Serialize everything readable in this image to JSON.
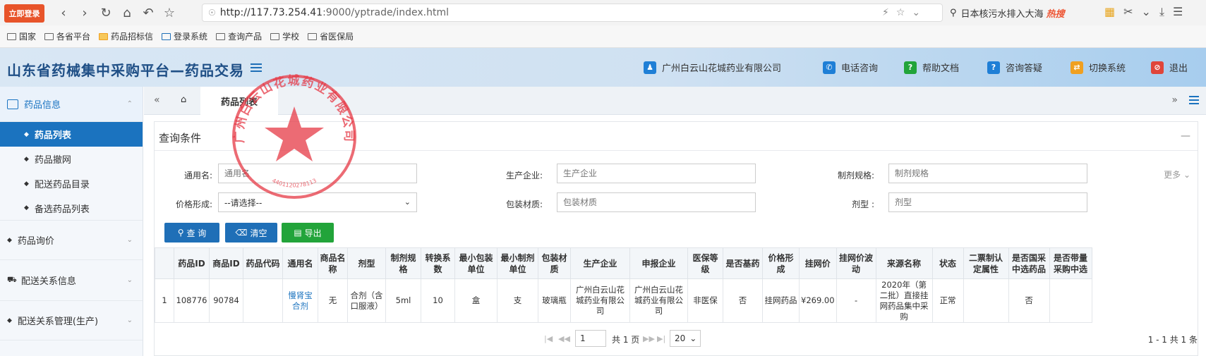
{
  "browser": {
    "login_badge": "立即登录",
    "url_host": "http://117.73.254.41",
    "url_path": ":9000/yptrade/index.html",
    "search_text": "日本核污水排入大海",
    "search_hot": "热搜",
    "bookmarks": [
      "国家",
      "各省平台",
      "药品招标信",
      "登录系统",
      "查询产品",
      "学校",
      "省医保局"
    ]
  },
  "header": {
    "title": "山东省药械集中采购平台—药品交易",
    "company": "广州白云山花城药业有限公司",
    "phone": "电话咨询",
    "help": "帮助文档",
    "faq": "咨询答疑",
    "switch": "切换系统",
    "logout": "退出",
    "colors": {
      "company": "#1f7fd6",
      "phone": "#1f7fd6",
      "help": "#22a43a",
      "faq": "#1f7fd6",
      "switch": "#f0a020",
      "logout": "#e0453a"
    }
  },
  "sidebar": {
    "section_drug": "药品信息",
    "items": [
      "药品列表",
      "药品撤网",
      "配送药品目录",
      "备选药品列表"
    ],
    "section_inquiry": "药品询价",
    "section_delivery": "配送关系信息",
    "section_delivery_mgmt": "配送关系管理(生产)"
  },
  "tabs": {
    "active": "药品列表"
  },
  "query": {
    "title": "查询条件",
    "more": "更多",
    "generic_name_label": "通用名:",
    "generic_name_placeholder": "通用名",
    "manufacturer_label": "生产企业:",
    "manufacturer_placeholder": "生产企业",
    "spec_label": "制剂规格:",
    "spec_placeholder": "制剂规格",
    "price_label": "价格形成:",
    "price_value": "--请选择--",
    "package_label": "包装材质:",
    "package_placeholder": "包装材质",
    "dosage_label": "剂型 :",
    "dosage_placeholder": "剂型",
    "btn_query": "查 询",
    "btn_clear": "清空",
    "btn_export": "导出"
  },
  "table": {
    "headers": [
      "药品ID",
      "商品ID",
      "药品代码",
      "通用名",
      "商品名称",
      "剂型",
      "制剂规格",
      "转换系数",
      "最小包装单位",
      "最小制剂单位",
      "包装材质",
      "生产企业",
      "申报企业",
      "医保等级",
      "是否基药",
      "价格形成",
      "挂网价",
      "挂网价波动",
      "来源名称",
      "状态",
      "二票制认定属性",
      "是否国采中选药品",
      "是否带量采购中选"
    ],
    "rows": [
      [
        "1",
        "108776",
        "90784",
        "",
        "慢肾宝合剂",
        "无",
        "合剂（含口服液）",
        "5ml",
        "10",
        "盒",
        "支",
        "玻璃瓶",
        "广州白云山花城药业有限公司",
        "广州白云山花城药业有限公司",
        "非医保",
        "否",
        "挂网药品",
        "¥269.00",
        "-",
        "2020年（第二批）直接挂网药品集中采购",
        "正常",
        "",
        "否",
        ""
      ]
    ]
  },
  "pager": {
    "current": "1",
    "total_pages": "共 1 页",
    "page_size": "20",
    "summary": "1 - 1  共 1 条"
  },
  "seal": {
    "text": "广州白云山花城药业有限公司",
    "number": "4401120278113"
  }
}
